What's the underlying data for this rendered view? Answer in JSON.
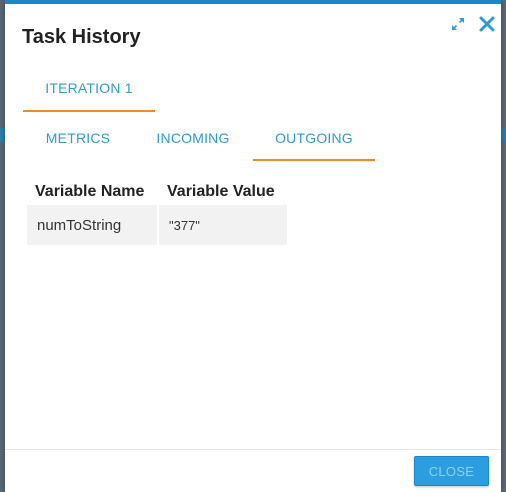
{
  "dialog": {
    "title": "Task History",
    "colors": {
      "accent": "#1a86c8",
      "tab_text": "#2e9ad6",
      "active_underline": "#f08c1e",
      "close_button": "#2a9ee0"
    },
    "icons": {
      "expand": "expand-arrows-icon",
      "close": "close-x-icon"
    }
  },
  "iteration_tabs": [
    {
      "label": "ITERATION 1",
      "active": true
    }
  ],
  "sub_tabs": [
    {
      "label": "METRICS",
      "active": false
    },
    {
      "label": "INCOMING",
      "active": false
    },
    {
      "label": "OUTGOING",
      "active": true
    }
  ],
  "variables": {
    "headers": [
      "Variable Name",
      "Variable Value"
    ],
    "rows": [
      {
        "name": "numToString",
        "value": "\"377\""
      }
    ]
  },
  "footer": {
    "close_label": "CLOSE"
  }
}
